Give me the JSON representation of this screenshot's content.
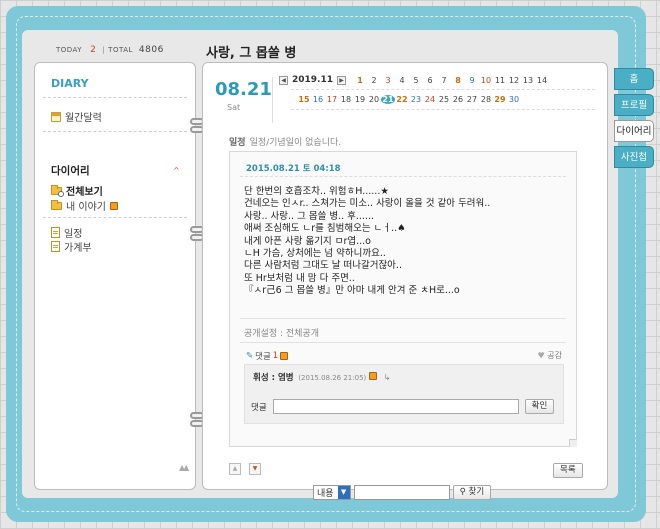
{
  "header": {
    "today_label": "TODAY",
    "today_count": "2",
    "total_label": "TOTAL",
    "total_count": "4806",
    "title": "사랑, 그 몹쓸 병"
  },
  "sidebar": {
    "title": "DIARY",
    "monthly_calendar": "월간달력",
    "section_title": "다이어리",
    "view_all": "전체보기",
    "my_story": "내 이야기",
    "schedule": "일정",
    "ledger": "가계부"
  },
  "tabs": [
    "홈",
    "프로필",
    "다이어리",
    "사진첩"
  ],
  "active_tab": "다이어리",
  "calendar": {
    "date": "08.21",
    "day": "Sat",
    "month": "2019.11",
    "row1": [
      "1",
      "2",
      "3",
      "4",
      "5",
      "6",
      "7",
      "8",
      "9",
      "10",
      "11",
      "12",
      "13",
      "14"
    ],
    "row2": [
      "15",
      "16",
      "17",
      "18",
      "19",
      "20",
      "21",
      "22",
      "23",
      "24",
      "25",
      "26",
      "27",
      "28",
      "29",
      "30"
    ],
    "selected": "21"
  },
  "schedule": {
    "label": "일정",
    "text": "일정/기념일이 없습니다."
  },
  "post": {
    "datetime": "2015.08.21 토 04:18",
    "lines": [
      "단 한번의 호흡조차.. 위험ㅎH......★",
      "건네오는 인ㅅr.. 스쳐가는 미소.. 사랑이 올을 것 같아 두려워..",
      "사랑.. 사랑.. 그 몹쓸 병.. 후......",
      "애써 조심해도 ㄴr를 침범해오는 ㄴㅓ..♠",
      "내게 아픈 사랑 옮기지 ㅁr엽...o",
      "ㄴH 가슴, 상처에는 넘 약하니까요..",
      "다른 사람처럼 그대도 날 떠나갈거잖아..",
      "또 Hr보처럼 내 맘 다 주면..",
      "『ㅅr己6 그 몹쓸 병』만 아마 내게 안겨 준 ㅊH로...o"
    ],
    "privacy": "공개설정 : 전체공개",
    "comments_label": "댓글",
    "comments_count": "1",
    "like_label": "공감"
  },
  "comment": {
    "author": "휘성 : 염병",
    "timestamp": "(2015.08.26 21:05)",
    "reply_icon": "reply-icon",
    "input_label": "댓글",
    "input_value": "",
    "confirm": "확인"
  },
  "controls": {
    "list_button": "목록",
    "search_select": "내용",
    "search_value": "",
    "search_button": "찾기"
  },
  "colors": {
    "frame": "#7fc8d8",
    "accent": "#2a9ab8",
    "today_highlight": "#37a8c0",
    "new_badge": "#f0a020"
  }
}
